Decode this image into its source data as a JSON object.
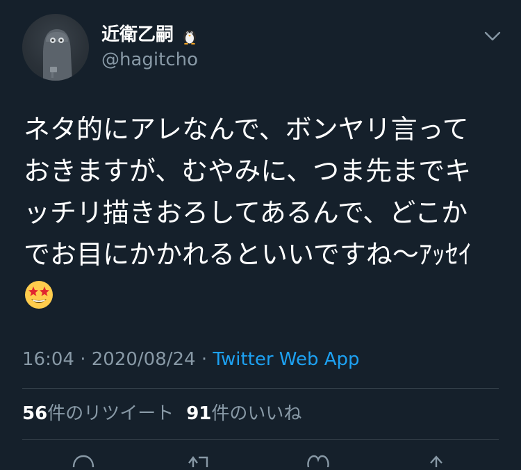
{
  "tweet": {
    "author": {
      "display_name": "近衛乙嗣",
      "name_emoji": "penguin-emoji",
      "handle": "@hagitcho"
    },
    "menu_icon": "chevron-down-icon",
    "text_lines": [
      "ネタ的にアレなんで、ボンヤリ言って",
      "おきますが、むやみに、つま先までキ",
      "ッチリ描きおろしてあるんで、どこか",
      "でお目にかかれるといいですね〜ｱｯｾｲ"
    ],
    "trailing_emoji": "star-struck-emoji",
    "meta": {
      "time": "16:04",
      "separator": " · ",
      "date": "2020/08/24",
      "source": "Twitter Web App"
    },
    "stats": {
      "retweets_count": "56",
      "retweets_label": "件のリツイート",
      "likes_count": "91",
      "likes_label": "件のいいね"
    },
    "actions": [
      "reply-icon",
      "retweet-icon",
      "like-icon",
      "share-icon"
    ]
  },
  "colors": {
    "background": "#15202b",
    "primary_text": "#ffffff",
    "secondary_text": "#8899a6",
    "link": "#1da1f2",
    "divider": "#38444d"
  }
}
